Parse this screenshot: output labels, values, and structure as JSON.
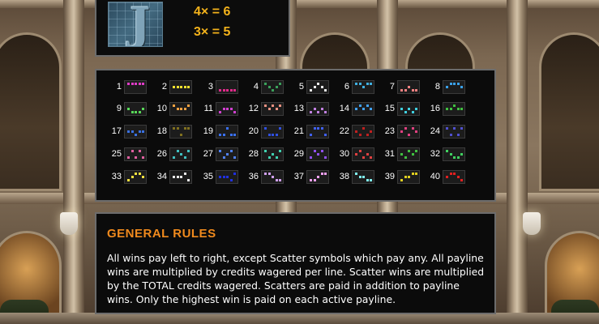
{
  "paytable": {
    "symbol_icon": "letter-J-blueprint-icon",
    "payouts": [
      "4× = 6",
      "3× = 5"
    ]
  },
  "paylines": [
    {
      "n": "1",
      "color": "#e03cc8",
      "rows": [
        0,
        0,
        0,
        0,
        0
      ]
    },
    {
      "n": "2",
      "color": "#f0e030",
      "rows": [
        1,
        1,
        1,
        1,
        1
      ]
    },
    {
      "n": "3",
      "color": "#e02a8a",
      "rows": [
        2,
        2,
        2,
        2,
        2
      ]
    },
    {
      "n": "4",
      "color": "#3aa05a",
      "rows": [
        0,
        1,
        2,
        1,
        0
      ]
    },
    {
      "n": "5",
      "color": "#e8e8e8",
      "rows": [
        2,
        1,
        0,
        1,
        2
      ]
    },
    {
      "n": "6",
      "color": "#40b0e0",
      "rows": [
        0,
        0,
        1,
        0,
        0
      ]
    },
    {
      "n": "7",
      "color": "#f08080",
      "rows": [
        2,
        2,
        1,
        2,
        2
      ]
    },
    {
      "n": "8",
      "color": "#3aa0e8",
      "rows": [
        1,
        0,
        0,
        0,
        1
      ]
    },
    {
      "n": "9",
      "color": "#58d858",
      "rows": [
        1,
        2,
        2,
        2,
        1
      ]
    },
    {
      "n": "10",
      "color": "#f0a040",
      "rows": [
        0,
        1,
        1,
        1,
        0
      ]
    },
    {
      "n": "11",
      "color": "#d040d0",
      "rows": [
        2,
        1,
        1,
        1,
        2
      ]
    },
    {
      "n": "12",
      "color": "#e89080",
      "rows": [
        0,
        1,
        0,
        1,
        0
      ]
    },
    {
      "n": "13",
      "color": "#c080e0",
      "rows": [
        2,
        1,
        2,
        1,
        2
      ]
    },
    {
      "n": "14",
      "color": "#40a0f0",
      "rows": [
        1,
        0,
        1,
        0,
        1
      ]
    },
    {
      "n": "15",
      "color": "#40d0e0",
      "rows": [
        1,
        2,
        1,
        2,
        1
      ]
    },
    {
      "n": "16",
      "color": "#40c040",
      "rows": [
        1,
        1,
        0,
        1,
        1
      ]
    },
    {
      "n": "17",
      "color": "#3a70e0",
      "rows": [
        1,
        1,
        2,
        1,
        1
      ]
    },
    {
      "n": "18",
      "color": "#807020",
      "rows": [
        0,
        0,
        2,
        0,
        0
      ]
    },
    {
      "n": "19",
      "color": "#3a70f0",
      "rows": [
        2,
        2,
        0,
        2,
        2
      ]
    },
    {
      "n": "20",
      "color": "#3050e0",
      "rows": [
        0,
        2,
        2,
        2,
        0
      ]
    },
    {
      "n": "21",
      "color": "#4060f0",
      "rows": [
        2,
        0,
        0,
        0,
        2
      ]
    },
    {
      "n": "22",
      "color": "#c02020",
      "rows": [
        1,
        2,
        0,
        2,
        1
      ]
    },
    {
      "n": "23",
      "color": "#e04080",
      "rows": [
        1,
        0,
        2,
        0,
        1
      ]
    },
    {
      "n": "24",
      "color": "#5050d0",
      "rows": [
        0,
        2,
        0,
        2,
        0
      ]
    },
    {
      "n": "25",
      "color": "#e060a0",
      "rows": [
        2,
        0,
        2,
        0,
        2
      ]
    },
    {
      "n": "26",
      "color": "#40c0c0",
      "rows": [
        2,
        0,
        1,
        2,
        0
      ]
    },
    {
      "n": "27",
      "color": "#5080f0",
      "rows": [
        0,
        2,
        1,
        0,
        2
      ]
    },
    {
      "n": "28",
      "color": "#40d0b0",
      "rows": [
        0,
        2,
        1,
        2,
        0
      ]
    },
    {
      "n": "29",
      "color": "#9050f0",
      "rows": [
        2,
        0,
        1,
        0,
        2
      ]
    },
    {
      "n": "30",
      "color": "#e04040",
      "rows": [
        1,
        0,
        2,
        1,
        2
      ]
    },
    {
      "n": "31",
      "color": "#40c040",
      "rows": [
        1,
        2,
        0,
        1,
        0
      ]
    },
    {
      "n": "32",
      "color": "#40d060",
      "rows": [
        0,
        1,
        2,
        2,
        1
      ]
    },
    {
      "n": "33",
      "color": "#f0e040",
      "rows": [
        2,
        1,
        0,
        0,
        1
      ]
    },
    {
      "n": "34",
      "color": "#e8e8e8",
      "rows": [
        1,
        1,
        1,
        0,
        2
      ]
    },
    {
      "n": "35",
      "color": "#2030e0",
      "rows": [
        1,
        1,
        1,
        2,
        0
      ]
    },
    {
      "n": "36",
      "color": "#d0a0f0",
      "rows": [
        0,
        0,
        1,
        2,
        2
      ]
    },
    {
      "n": "37",
      "color": "#f0a0f0",
      "rows": [
        2,
        2,
        1,
        0,
        0
      ]
    },
    {
      "n": "38",
      "color": "#80f0f0",
      "rows": [
        0,
        1,
        1,
        2,
        2
      ]
    },
    {
      "n": "39",
      "color": "#e0d020",
      "rows": [
        2,
        1,
        1,
        0,
        0
      ]
    },
    {
      "n": "40",
      "color": "#e02020",
      "rows": [
        1,
        0,
        0,
        1,
        2
      ]
    }
  ],
  "rules": {
    "title": "GENERAL RULES",
    "text": "All wins pay left to right, except Scatter symbols which pay any. All payline wins are multiplied by credits wagered per line. Scatter wins are multiplied by the TOTAL credits wagered. Scatters are paid in addition to payline wins. Only the highest win is paid on each active payline."
  }
}
